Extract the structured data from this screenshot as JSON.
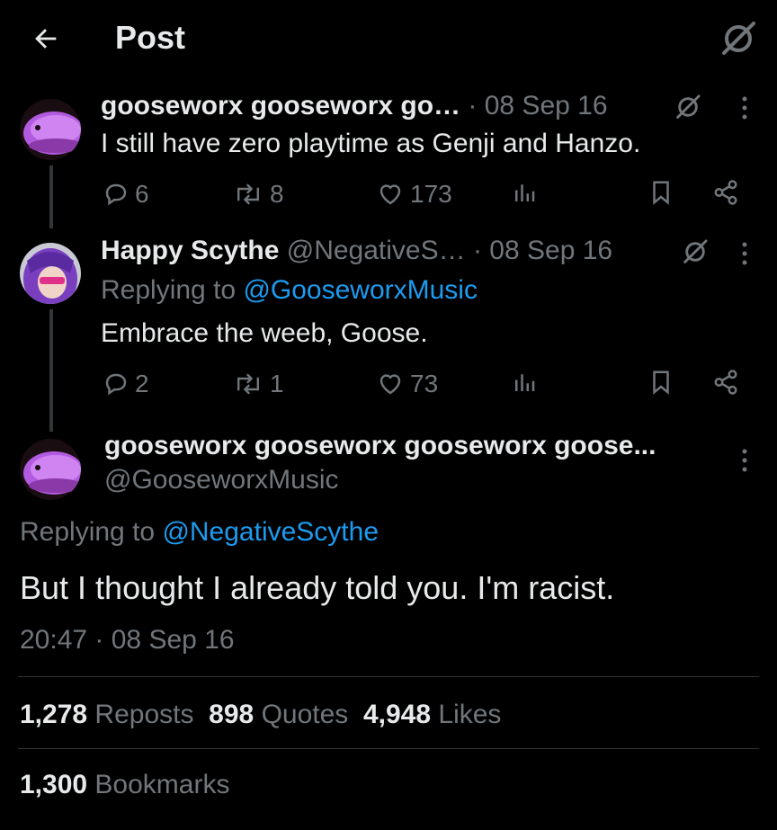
{
  "header": {
    "title": "Post",
    "back_icon": "arrow-left-icon",
    "grok_icon": "grok-icon"
  },
  "tweet1": {
    "name": "gooseworx gooseworx go…",
    "date": "· 08 Sep 16",
    "text": "I still have zero playtime as Genji and Hanzo.",
    "replies": "6",
    "reposts": "8",
    "likes": "173"
  },
  "tweet2": {
    "name": "Happy Scythe",
    "handle": "@NegativeS…",
    "date": "· 08 Sep 16",
    "replying_prefix": "Replying to ",
    "replying_to": "@GooseworxMusic",
    "text": "Embrace the weeb, Goose.",
    "replies": "2",
    "reposts": "1",
    "likes": "73"
  },
  "main": {
    "name": "gooseworx gooseworx gooseworx goose...",
    "handle": "@GooseworxMusic",
    "replying_prefix": "Replying to ",
    "replying_to": "@NegativeScythe",
    "text": "But I thought I already told you. I'm racist.",
    "time": "20:47 · 08 Sep 16"
  },
  "stats": {
    "reposts_count": "1,278",
    "reposts_label": "Reposts",
    "quotes_count": "898",
    "quotes_label": "Quotes",
    "likes_count": "4,948",
    "likes_label": "Likes",
    "bookmarks_count": "1,300",
    "bookmarks_label": "Bookmarks"
  },
  "colors": {
    "background": "#000000",
    "text": "#e7e9ea",
    "muted": "#71767b",
    "link": "#1d9bf0",
    "divider": "#2f3336"
  }
}
